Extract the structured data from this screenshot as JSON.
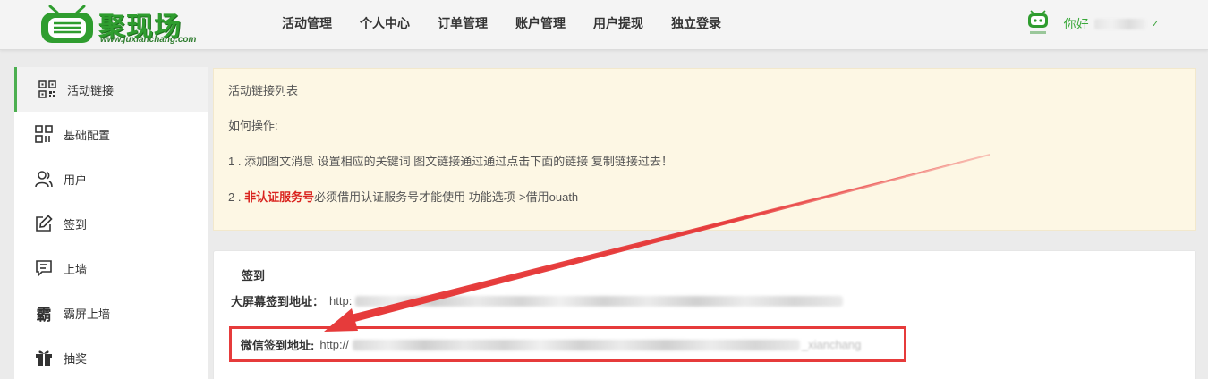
{
  "header": {
    "logo_text": "聚现场",
    "logo_url": "www.juxianchang.com",
    "nav": [
      {
        "label": "活动管理"
      },
      {
        "label": "个人中心"
      },
      {
        "label": "订单管理"
      },
      {
        "label": "账户管理"
      },
      {
        "label": "用户提现"
      },
      {
        "label": "独立登录"
      }
    ],
    "greeting": "你好",
    "brand_color": "#39a839"
  },
  "sidebar": {
    "items": [
      {
        "label": "活动链接",
        "icon": "qrcode-icon",
        "active": true
      },
      {
        "label": "基础配置",
        "icon": "grid-icon"
      },
      {
        "label": "用户",
        "icon": "users-icon"
      },
      {
        "label": "签到",
        "icon": "edit-icon"
      },
      {
        "label": "上墙",
        "icon": "message-icon"
      },
      {
        "label": "霸屏上墙",
        "icon": "ba-icon"
      },
      {
        "label": "抽奖",
        "icon": "gift-icon"
      }
    ]
  },
  "notice": {
    "title": "活动链接列表",
    "how": "如何操作:",
    "step1": "1 . 添加图文消息 设置相应的关键词 图文链接通过通过点击下面的链接 复制链接过去！",
    "step2_prefix": "2 . ",
    "step2_strong": "非认证服务号",
    "step2_rest": "必须借用认证服务号才能使用 功能选项->借用ouath",
    "accent_color": "#d9231e"
  },
  "links": {
    "title": "签到",
    "bigscreen_label": "大屏幕签到地址：",
    "bigscreen_value": "http:",
    "wechat_label": "微信签到地址:",
    "wechat_value": "http://",
    "wechat_tail": "_xianchang",
    "highlight_color": "#e63b3b"
  }
}
